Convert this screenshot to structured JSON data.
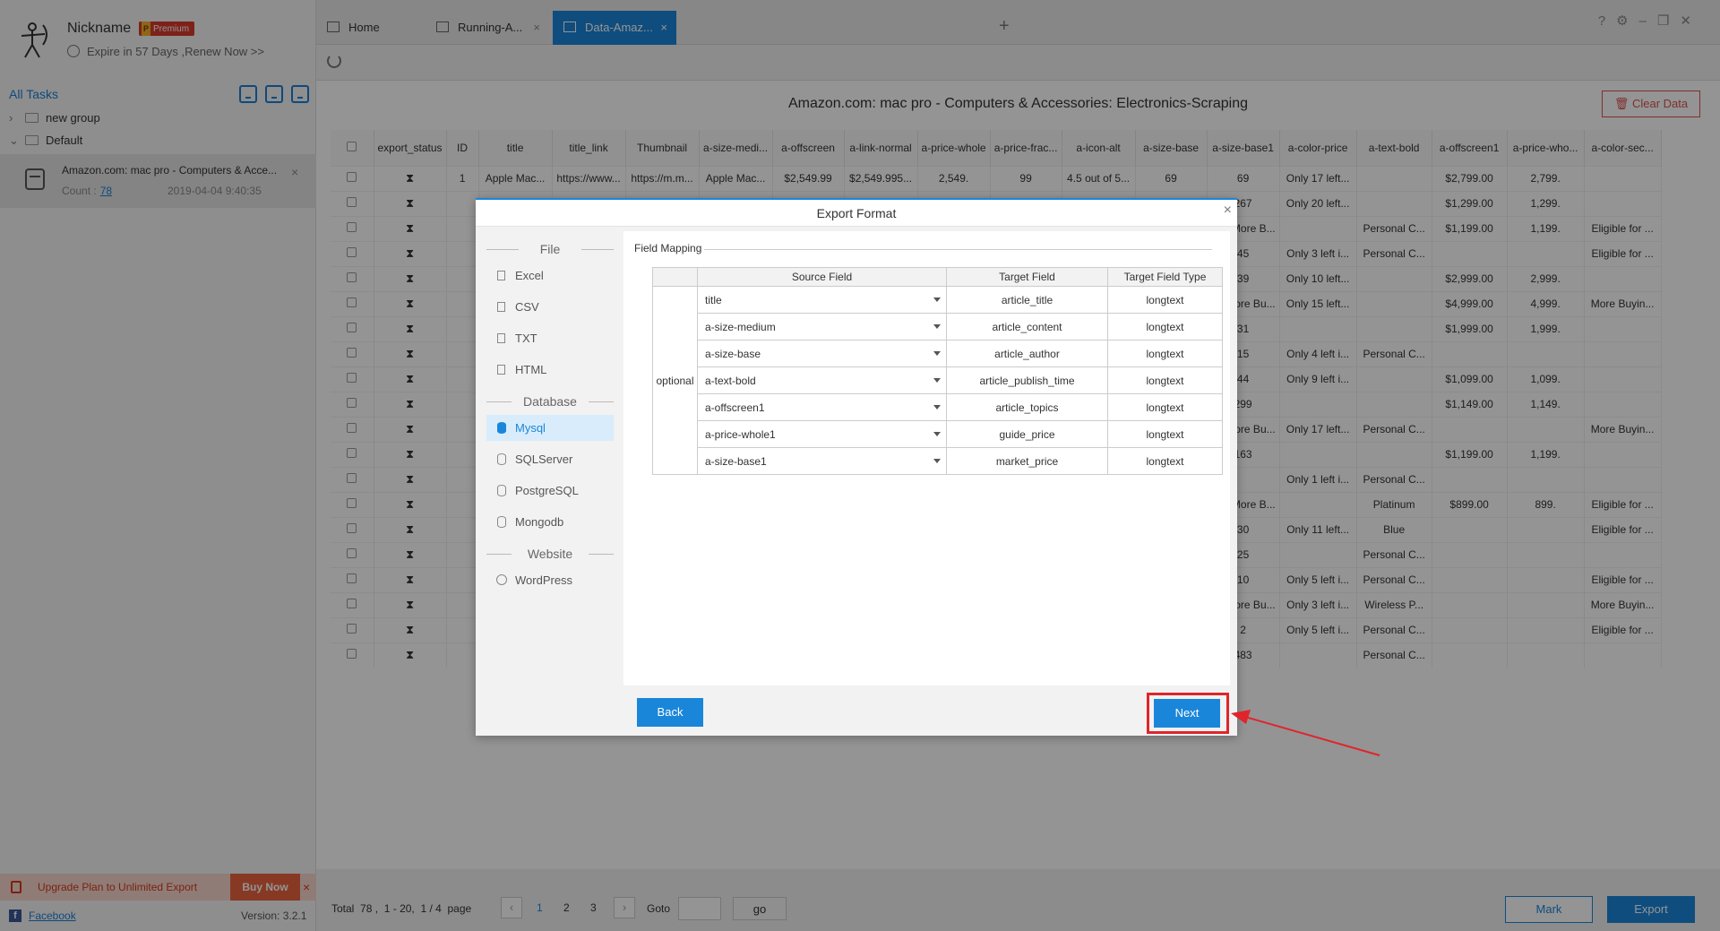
{
  "sidebar": {
    "nickname": "Nickname",
    "premium_badge": "Premium",
    "premium_letter": "P",
    "expire_text": "Expire in 57 Days ,Renew Now >>",
    "all_tasks": "All Tasks",
    "tree": {
      "group": "new group",
      "default": "Default"
    },
    "task": {
      "title": "Amazon.com: mac pro - Computers & Acce...",
      "count_label": "Count :",
      "count_value": "78",
      "date": "2019-04-04 9:40:35"
    },
    "upgrade_text": "Upgrade Plan to Unlimited Export",
    "buy_now": "Buy Now",
    "facebook": "Facebook",
    "version": "Version: 3.2.1"
  },
  "tabs": [
    {
      "label": "Home"
    },
    {
      "label": "Running-A..."
    },
    {
      "label": "Data-Amaz..."
    }
  ],
  "main": {
    "title": "Amazon.com: mac pro - Computers & Accessories: Electronics-Scraping",
    "clear_data": "Clear Data",
    "columns": [
      "export_status",
      "ID",
      "title",
      "title_link",
      "Thumbnail",
      "a-size-medi...",
      "a-offscreen",
      "a-link-normal",
      "a-price-whole",
      "a-price-frac...",
      "a-icon-alt",
      "a-size-base",
      "a-size-base1",
      "a-color-price",
      "a-text-bold",
      "a-offscreen1",
      "a-price-who...",
      "a-color-sec..."
    ],
    "first_row": [
      "1",
      "Apple Mac...",
      "https://www...",
      "https://m.m...",
      "Apple Mac...",
      "$2,549.99",
      "$2,549.995...",
      "2,549.",
      "99",
      "4.5 out of 5...",
      "69"
    ],
    "right_rows": [
      [
        "69",
        "Only 17 left...",
        "",
        "$2,799.00",
        "2,799.",
        ""
      ],
      [
        "267",
        "Only 20 left...",
        "",
        "$1,299.00",
        "1,299.",
        ""
      ],
      [
        "321,More B...",
        "",
        "Personal C...",
        "$1,199.00",
        "1,199.",
        "Eligible for ..."
      ],
      [
        "45",
        "Only 3 left i...",
        "Personal C...",
        "",
        "",
        "Eligible for ..."
      ],
      [
        "39",
        "Only 10 left...",
        "",
        "$2,999.00",
        "2,999.",
        ""
      ],
      [
        "14,More Bu...",
        "Only 15 left...",
        "",
        "$4,999.00",
        "4,999.",
        "More Buyin..."
      ],
      [
        "31",
        "",
        "",
        "$1,999.00",
        "1,999.",
        ""
      ],
      [
        "15",
        "Only 4 left i...",
        "Personal C...",
        "",
        "",
        ""
      ],
      [
        "44",
        "Only 9 left i...",
        "",
        "$1,099.00",
        "1,099.",
        ""
      ],
      [
        "299",
        "",
        "",
        "$1,149.00",
        "1,149.",
        ""
      ],
      [
        "24,More Bu...",
        "Only 17 left...",
        "Personal C...",
        "",
        "",
        "More Buyin..."
      ],
      [
        "163",
        "",
        "",
        "$1,199.00",
        "1,199.",
        ""
      ],
      [
        "",
        "Only 1 left i...",
        "Personal C...",
        "",
        "",
        ""
      ],
      [
        "187,More B...",
        "",
        "Platinum",
        "$899.00",
        "899.",
        "Eligible for ..."
      ],
      [
        "30",
        "Only 11 left...",
        "Blue",
        "",
        "",
        "Eligible for ..."
      ],
      [
        "25",
        "",
        "Personal C...",
        "",
        "",
        ""
      ],
      [
        "10",
        "Only 5 left i...",
        "Personal C...",
        "",
        "",
        "Eligible for ..."
      ],
      [
        "22,More Bu...",
        "Only 3 left i...",
        "Wireless P...",
        "",
        "",
        "More Buyin..."
      ],
      [
        "2",
        "Only 5 left i...",
        "Personal C...",
        "",
        "",
        "Eligible for ..."
      ],
      [
        "483",
        "",
        "Personal C...",
        "",
        "",
        ""
      ]
    ],
    "status_glyph": "⧗"
  },
  "pager": {
    "total_label": "Total",
    "total": "78",
    "range": "1 - 20",
    "page_info": "1 / 4",
    "page_word": "page",
    "pages": [
      "1",
      "2",
      "3"
    ],
    "goto_label": "Goto",
    "go": "go",
    "mark": "Mark",
    "export": "Export"
  },
  "modal": {
    "title": "Export Format",
    "groups": {
      "file": "File",
      "database": "Database",
      "website": "Website"
    },
    "file_items": [
      "Excel",
      "CSV",
      "TXT",
      "HTML"
    ],
    "db_items": [
      "Mysql",
      "SQLServer",
      "PostgreSQL",
      "Mongodb"
    ],
    "web_items": [
      "WordPress"
    ],
    "selected": "Mysql",
    "field_mapping": "Field Mapping",
    "headers": {
      "source": "Source Field",
      "target": "Target Field",
      "type": "Target Field Type"
    },
    "optional_label": "optional",
    "rows": [
      {
        "source": "title",
        "target": "article_title",
        "type": "longtext"
      },
      {
        "source": "a-size-medium",
        "target": "article_content",
        "type": "longtext"
      },
      {
        "source": "a-size-base",
        "target": "article_author",
        "type": "longtext"
      },
      {
        "source": "a-text-bold",
        "target": "article_publish_time",
        "type": "longtext"
      },
      {
        "source": "a-offscreen1",
        "target": "article_topics",
        "type": "longtext"
      },
      {
        "source": "a-price-whole1",
        "target": "guide_price",
        "type": "longtext"
      },
      {
        "source": "a-size-base1",
        "target": "market_price",
        "type": "longtext"
      }
    ],
    "back": "Back",
    "next": "Next"
  },
  "colors": {
    "accent": "#1a86d9",
    "highlight_red": "#e0242b",
    "status_green": "#1a9a4a"
  }
}
